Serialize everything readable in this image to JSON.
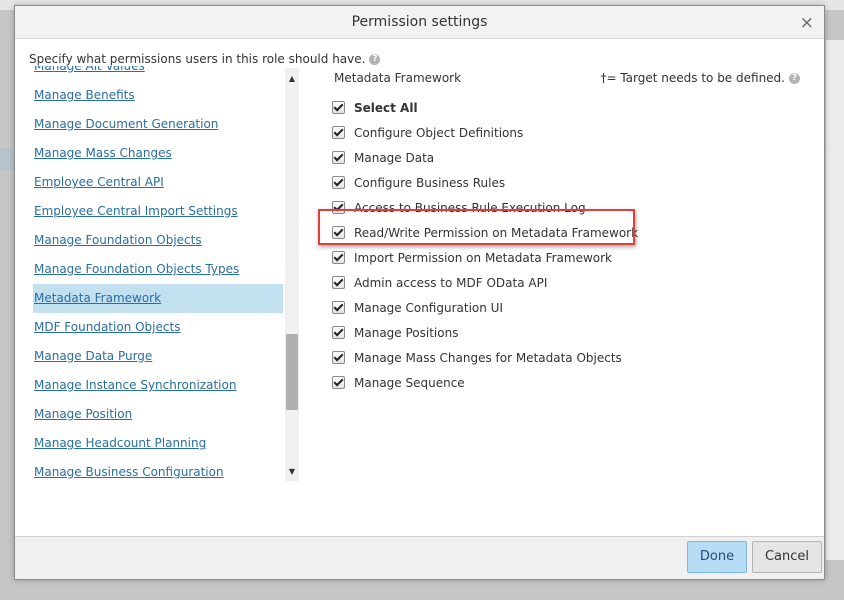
{
  "dialog": {
    "title": "Permission settings",
    "close_label": "×",
    "instruction": "Specify what permissions users in this role should have.",
    "help_glyph": "?"
  },
  "left_nav": {
    "items": [
      {
        "label": "Manage Alt Values"
      },
      {
        "label": "Manage Benefits"
      },
      {
        "label": "Manage Document Generation"
      },
      {
        "label": "Manage Mass Changes"
      },
      {
        "label": "Employee Central API"
      },
      {
        "label": "Employee Central Import Settings"
      },
      {
        "label": "Manage Foundation Objects"
      },
      {
        "label": "Manage Foundation Objects Types"
      },
      {
        "label": "Metadata Framework"
      },
      {
        "label": "MDF Foundation Objects"
      },
      {
        "label": "Manage Data Purge"
      },
      {
        "label": "Manage Instance Synchronization"
      },
      {
        "label": "Manage Position"
      },
      {
        "label": "Manage Headcount Planning"
      },
      {
        "label": "Manage Business Configuration"
      }
    ],
    "selected_index": 8,
    "scroll_up_icon": "▲",
    "scroll_down_icon": "▼"
  },
  "permissions_panel": {
    "title": "Metadata Framework",
    "target_note": "†= Target needs to be defined.",
    "items": [
      {
        "label": "Select All",
        "checked": true
      },
      {
        "label": "Configure Object Definitions",
        "checked": true
      },
      {
        "label": "Manage Data",
        "checked": true
      },
      {
        "label": "Configure Business Rules",
        "checked": true
      },
      {
        "label": "Access to Business Rule Execution Log",
        "checked": true
      },
      {
        "label": "Read/Write Permission on Metadata Framework",
        "checked": true
      },
      {
        "label": "Import Permission on Metadata Framework",
        "checked": true
      },
      {
        "label": "Admin access to MDF OData API",
        "checked": true
      },
      {
        "label": "Manage Configuration UI",
        "checked": true
      },
      {
        "label": "Manage Positions",
        "checked": true
      },
      {
        "label": "Manage Mass Changes for Metadata Objects",
        "checked": true
      },
      {
        "label": "Manage Sequence",
        "checked": true
      }
    ],
    "highlight_color": "#e53c3c"
  },
  "footer": {
    "done_label": "Done",
    "cancel_label": "Cancel"
  },
  "colors": {
    "link": "#2a6ea0",
    "selected_bg": "#c3e0f0",
    "done_bg": "#b7dcf5"
  }
}
